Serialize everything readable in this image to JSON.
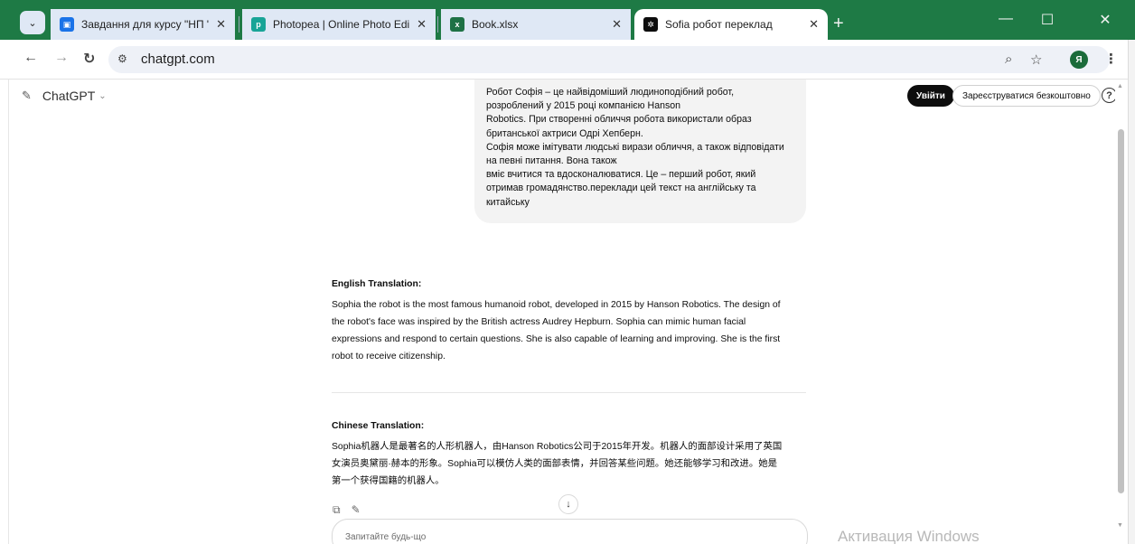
{
  "browser": {
    "tabs": [
      {
        "title": "Завдання для курсу \"НП \"Циф",
        "favicon": "classroom-icon",
        "color": "#1a73e8",
        "close": "✕"
      },
      {
        "title": "Photopea | Online Photo Editor",
        "favicon": "photopea-icon",
        "color": "#18a497",
        "close": "✕"
      },
      {
        "title": "Book.xlsx",
        "favicon": "excel-icon",
        "color": "#1e7145",
        "close": "✕"
      },
      {
        "title": "Sofia робот переклад",
        "favicon": "chatgpt-icon",
        "color": "#0d0d0d",
        "close": "✕"
      }
    ],
    "active_tab_index": 3,
    "new_tab": "+",
    "url": "chatgpt.com",
    "profile_initial": "Я",
    "frame_color": "#1e7a45"
  },
  "chat": {
    "model_label": "ChatGPT",
    "login_label": "Увійти",
    "signup_label": "Зареєструватися безкоштовно",
    "help_label": "?",
    "user_message_lines": [
      "Робот Софія – це найвідоміший людиноподібний робот,",
      "розроблений у 2015 році компанією Hanson",
      "Robotics. При створенні обличчя робота використали образ",
      "британської актриси Одрі Хепберн.",
      "Софія може імітувати людські вирази обличчя, а також відповідати",
      "на певні питання. Вона також",
      "вміє вчитися та вдосконалюватися. Це – перший робот, який",
      "отримав громадянство.переклади цей текст на англійську та",
      "китайську"
    ],
    "english": {
      "heading": "English Translation:",
      "lines": [
        "Sophia the robot is the most famous humanoid robot, developed in 2015 by Hanson Robotics. The design of",
        "the robot's face was inspired by the British actress Audrey Hepburn. Sophia can mimic human facial",
        "expressions and respond to certain questions. She is also capable of learning and improving. She is the first",
        "robot to receive citizenship."
      ]
    },
    "chinese": {
      "heading": "Chinese Translation:",
      "lines": [
        "Sophia机器人是最著名的人形机器人，由Hanson Robotics公司于2015年开发。机器人的面部设计采用了英国",
        "女演员奥黛丽·赫本的形象。Sophia可以模仿人类的面部表情，并回答某些问题。她还能够学习和改进。她是",
        "第一个获得国籍的机器人。"
      ]
    },
    "composer_placeholder": "Запитайте будь-що"
  },
  "os": {
    "activation_text": "Активация Windows"
  }
}
